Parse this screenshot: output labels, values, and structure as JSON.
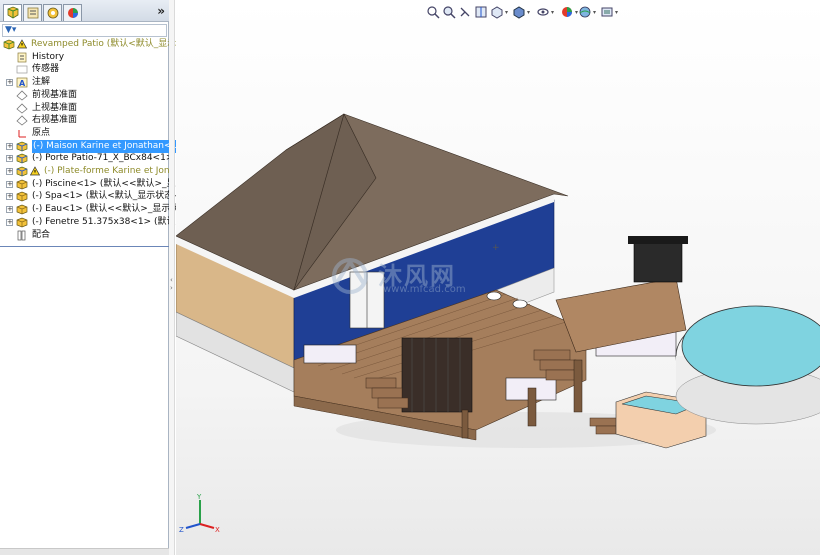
{
  "feature_manager": {
    "collapse_label": "»",
    "filter_icon": "funnel-icon",
    "tree": [
      {
        "label": "Revamped Patio  (默认<默认_显示",
        "icon": "assembly-icon",
        "warning": true,
        "style": "olive",
        "expand": "-"
      },
      {
        "label": "History",
        "icon": "history-icon",
        "warning": false,
        "style": "normal",
        "expand": ""
      },
      {
        "label": "传感器",
        "icon": "sensor-icon",
        "warning": false,
        "style": "normal",
        "expand": ""
      },
      {
        "label": "注解",
        "icon": "annotation-icon",
        "warning": false,
        "style": "normal",
        "expand": "+"
      },
      {
        "label": "前视基准面",
        "icon": "plane-icon",
        "warning": false,
        "style": "normal",
        "expand": ""
      },
      {
        "label": "上视基准面",
        "icon": "plane-icon",
        "warning": false,
        "style": "normal",
        "expand": ""
      },
      {
        "label": "右视基准面",
        "icon": "plane-icon",
        "warning": false,
        "style": "normal",
        "expand": ""
      },
      {
        "label": "原点",
        "icon": "origin-icon",
        "warning": false,
        "style": "normal",
        "expand": ""
      },
      {
        "label": "(-) Maison Karine et Jonathan<1",
        "icon": "subassembly-icon",
        "warning": false,
        "style": "selected",
        "expand": "+"
      },
      {
        "label": "(-) Porte Patio-71_X_BCx84<1> (",
        "icon": "subassembly-icon",
        "warning": false,
        "style": "normal",
        "expand": "+"
      },
      {
        "label": "(-) Plate-forme Karine et Jona",
        "icon": "subassembly-icon",
        "warning": true,
        "style": "olive",
        "expand": "+"
      },
      {
        "label": "(-) Piscine<1> (默认<<默认>_显示",
        "icon": "part-icon",
        "warning": false,
        "style": "normal",
        "expand": "+"
      },
      {
        "label": "(-) Spa<1> (默认<默认_显示状态-",
        "icon": "part-icon",
        "warning": false,
        "style": "normal",
        "expand": "+"
      },
      {
        "label": "(-) Eau<1> (默认<<默认>_显示状",
        "icon": "part-icon",
        "warning": false,
        "style": "normal",
        "expand": "+"
      },
      {
        "label": "(-) Fenetre 51.375x38<1> (默认<",
        "icon": "part-icon",
        "warning": false,
        "style": "normal",
        "expand": "+"
      },
      {
        "label": "配合",
        "icon": "mates-icon",
        "warning": false,
        "style": "normal",
        "expand": ""
      }
    ]
  },
  "viewport": {
    "watermark_text": "沐风网",
    "watermark_url": "www.mfcad.com",
    "triad_labels": {
      "x": "X",
      "y": "Y",
      "z": "Z"
    },
    "hud_icons": [
      "zoom-fit-icon",
      "zoom-area-icon",
      "previous-view-icon",
      "section-view-icon",
      "view-orientation-icon",
      "display-style-icon",
      "hide-show-icon",
      "appearance-icon",
      "scene-icon",
      "view-settings-icon"
    ]
  },
  "colors": {
    "selection": "#3399ff",
    "olive_text": "#8e8b2a",
    "house_wall": "#1f3f95",
    "roof": "#7a6a5a",
    "deck": "#a57e5c",
    "water": "#7fd3e0"
  }
}
